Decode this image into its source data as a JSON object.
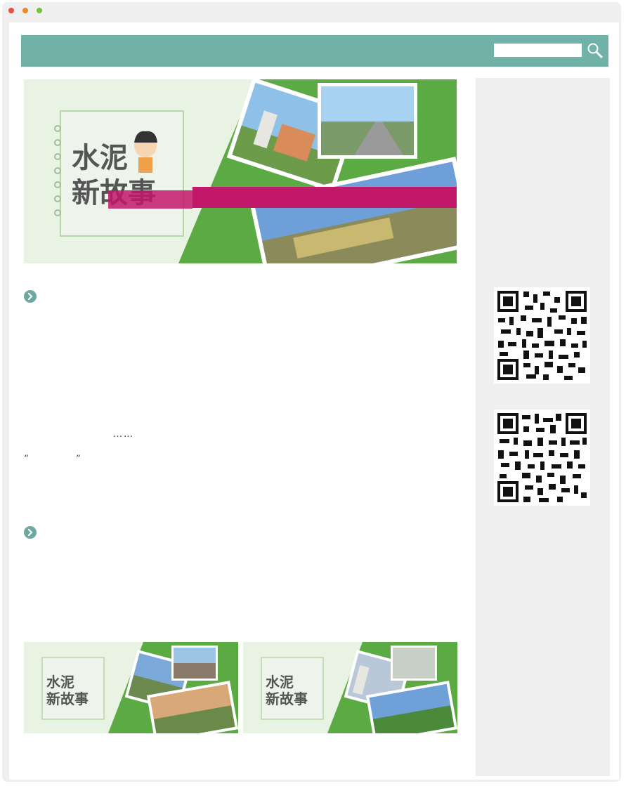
{
  "window": {
    "controls": [
      "close",
      "minimize",
      "maximize"
    ]
  },
  "header": {
    "search": {
      "value": "",
      "placeholder": ""
    },
    "search_icon": "search-icon",
    "bar_color": "#70b1a8"
  },
  "hero": {
    "title_line1": "水泥",
    "title_line2": "新故事",
    "bg_color": "#5caa43",
    "banner_color": "#c2186a"
  },
  "article": {
    "section1_icon": "chevron-right-icon",
    "ellipsis": "……",
    "quote_open": "“",
    "quote_close": "”",
    "section2_icon": "chevron-right-icon"
  },
  "thumbnails": [
    {
      "title_line1": "水泥",
      "title_line2": "新故事"
    },
    {
      "title_line1": "水泥",
      "title_line2": "新故事"
    }
  ],
  "sidebar": {
    "qr_codes": [
      "qr-code-1",
      "qr-code-2"
    ]
  }
}
